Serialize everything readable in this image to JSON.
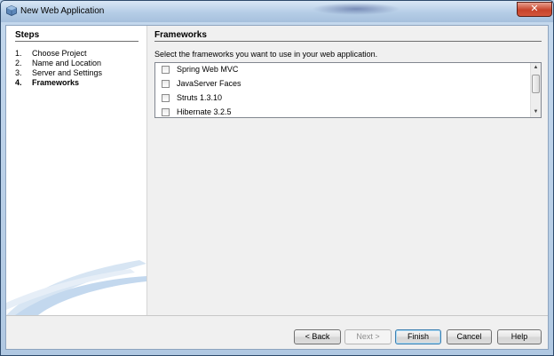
{
  "window": {
    "title": "New Web Application",
    "close_glyph": "✕",
    "title_icon": "netbeans-cube-icon"
  },
  "steps": {
    "title": "Steps",
    "items": [
      {
        "num": "1.",
        "label": "Choose Project",
        "active": false
      },
      {
        "num": "2.",
        "label": "Name and Location",
        "active": false
      },
      {
        "num": "3.",
        "label": "Server and Settings",
        "active": false
      },
      {
        "num": "4.",
        "label": "Frameworks",
        "active": true
      }
    ]
  },
  "content": {
    "title": "Frameworks",
    "description": "Select the frameworks you want to use in your web application.",
    "frameworks": [
      {
        "label": "Spring Web MVC",
        "checked": false
      },
      {
        "label": "JavaServer Faces",
        "checked": false
      },
      {
        "label": "Struts 1.3.10",
        "checked": false
      },
      {
        "label": "Hibernate 3.2.5",
        "checked": false
      }
    ],
    "scroll_up_glyph": "▲",
    "scroll_down_glyph": "▼"
  },
  "buttons": {
    "back": "< Back",
    "next": "Next >",
    "finish": "Finish",
    "cancel": "Cancel",
    "help": "Help"
  },
  "colors": {
    "frame": "#b9d1ea",
    "close": "#c7432b",
    "panel": "#f0f0f0"
  }
}
